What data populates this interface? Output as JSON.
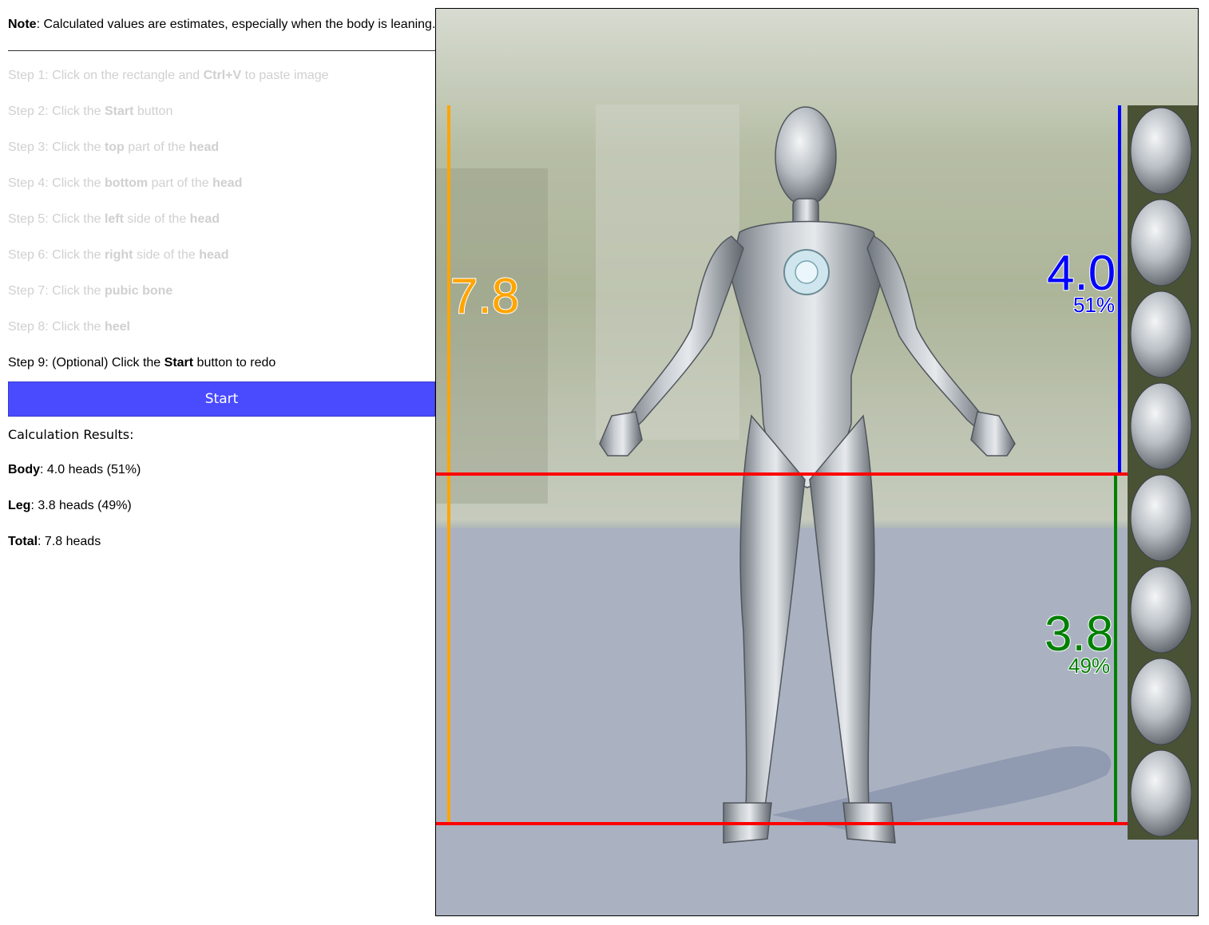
{
  "note": {
    "label": "Note",
    "text": ": Calculated values are estimates, especially when the body is leaning."
  },
  "steps": [
    {
      "prefix": "Step 1: Click on the rectangle and ",
      "bold1": "Ctrl+V",
      "mid": " to paste image",
      "bold2": "",
      "suffix": ""
    },
    {
      "prefix": "Step 2: Click the ",
      "bold1": "Start",
      "mid": " button",
      "bold2": "",
      "suffix": ""
    },
    {
      "prefix": "Step 3: Click the ",
      "bold1": "top",
      "mid": " part of the ",
      "bold2": "head",
      "suffix": ""
    },
    {
      "prefix": "Step 4: Click the ",
      "bold1": "bottom",
      "mid": " part of the ",
      "bold2": "head",
      "suffix": ""
    },
    {
      "prefix": "Step 5: Click the ",
      "bold1": "left",
      "mid": " side of the ",
      "bold2": "head",
      "suffix": ""
    },
    {
      "prefix": "Step 6: Click the ",
      "bold1": "right",
      "mid": " side of the ",
      "bold2": "head",
      "suffix": ""
    },
    {
      "prefix": "Step 7: Click the ",
      "bold1": "pubic bone",
      "mid": "",
      "bold2": "",
      "suffix": ""
    },
    {
      "prefix": "Step 8: Click the ",
      "bold1": "heel",
      "mid": "",
      "bold2": "",
      "suffix": ""
    },
    {
      "prefix": "Step 9: (Optional) Click the ",
      "bold1": "Start",
      "mid": " button to redo",
      "bold2": "",
      "suffix": ""
    }
  ],
  "start_button": "Start",
  "results": {
    "title": "Calculation Results:",
    "body_label": "Body",
    "body_value": ": 4.0 heads (51%)",
    "leg_label": "Leg",
    "leg_value": ": 3.8 heads (49%)",
    "total_label": "Total",
    "total_value": ": 7.8 heads"
  },
  "overlay": {
    "total": "7.8",
    "body": "4.0",
    "body_pct": "51%",
    "leg": "3.8",
    "leg_pct": "49%"
  },
  "colors": {
    "total": "#ffa500",
    "body": "#0000ff",
    "leg": "#008000",
    "markers": "#ff0000",
    "start": "#4a4aff"
  }
}
